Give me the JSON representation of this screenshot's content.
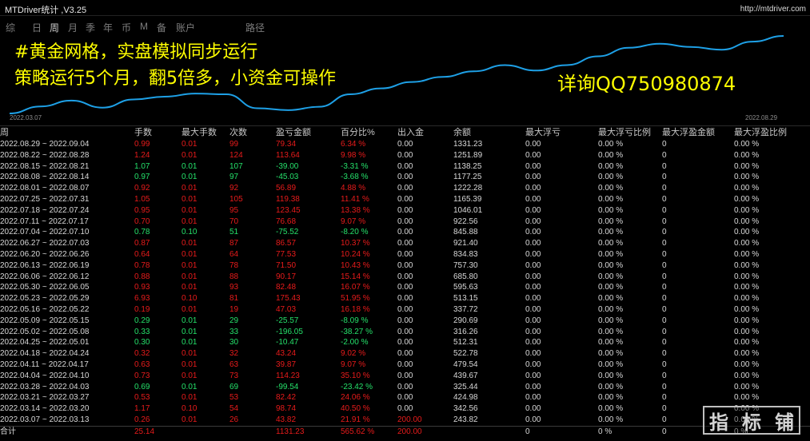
{
  "window": {
    "title": "MTDriver统计 ,V3.25",
    "link": "http://mtdriver.com"
  },
  "tabs": [
    "综",
    "日",
    "周",
    "月",
    "季",
    "年",
    "币",
    "M",
    "备",
    "账户",
    "路径"
  ],
  "active_tab": "周",
  "promo": {
    "line1": "#黄金网格，实盘模拟同步运行",
    "line2": "策略运行5个月，翻5倍多，小资金可操作",
    "contact": "详询QQ750980874"
  },
  "colors": {
    "curve": "#1ea0e6",
    "promo": "#ffff00",
    "positive": "#e81b1b",
    "negative": "#25e06a"
  },
  "chart_data": {
    "type": "line",
    "x_start": "2022.03.07",
    "x_end": "2022.08.29",
    "series": [
      {
        "values": [
          243.82,
          342.56,
          424.98,
          325.44,
          439.67,
          479.54,
          522.78,
          512.31,
          316.26,
          290.69,
          337.72,
          513.15,
          595.63,
          685.8,
          757.3,
          834.83,
          921.4,
          845.88,
          922.56,
          1046.01,
          1165.39,
          1222.28,
          1177.25,
          1138.25,
          1251.89,
          1331.23
        ]
      }
    ]
  },
  "table": {
    "headers": [
      "周",
      "手数",
      "最大手数",
      "次数",
      "盈亏金额",
      "百分比%",
      "出入金",
      "余额",
      "最大浮亏",
      "最大浮亏比例",
      "最大浮盈金额",
      "最大浮盈比例"
    ],
    "rows": [
      [
        "2022.08.29 ~ 2022.09.04",
        "0.99",
        "0.01",
        "99",
        "79.34",
        "6.34 %",
        "0.00",
        "1331.23",
        "0.00",
        "0.00 %",
        "0",
        "0.00 %"
      ],
      [
        "2022.08.22 ~ 2022.08.28",
        "1.24",
        "0.01",
        "124",
        "113.64",
        "9.98 %",
        "0.00",
        "1251.89",
        "0.00",
        "0.00 %",
        "0",
        "0.00 %"
      ],
      [
        "2022.08.15 ~ 2022.08.21",
        "1.07",
        "0.01",
        "107",
        "-39.00",
        "-3.31 %",
        "0.00",
        "1138.25",
        "0.00",
        "0.00 %",
        "0",
        "0.00 %"
      ],
      [
        "2022.08.08 ~ 2022.08.14",
        "0.97",
        "0.01",
        "97",
        "-45.03",
        "-3.68 %",
        "0.00",
        "1177.25",
        "0.00",
        "0.00 %",
        "0",
        "0.00 %"
      ],
      [
        "2022.08.01 ~ 2022.08.07",
        "0.92",
        "0.01",
        "92",
        "56.89",
        "4.88 %",
        "0.00",
        "1222.28",
        "0.00",
        "0.00 %",
        "0",
        "0.00 %"
      ],
      [
        "2022.07.25 ~ 2022.07.31",
        "1.05",
        "0.01",
        "105",
        "119.38",
        "11.41 %",
        "0.00",
        "1165.39",
        "0.00",
        "0.00 %",
        "0",
        "0.00 %"
      ],
      [
        "2022.07.18 ~ 2022.07.24",
        "0.95",
        "0.01",
        "95",
        "123.45",
        "13.38 %",
        "0.00",
        "1046.01",
        "0.00",
        "0.00 %",
        "0",
        "0.00 %"
      ],
      [
        "2022.07.11 ~ 2022.07.17",
        "0.70",
        "0.01",
        "70",
        "76.68",
        "9.07 %",
        "0.00",
        "922.56",
        "0.00",
        "0.00 %",
        "0",
        "0.00 %"
      ],
      [
        "2022.07.04 ~ 2022.07.10",
        "0.78",
        "0.10",
        "51",
        "-75.52",
        "-8.20 %",
        "0.00",
        "845.88",
        "0.00",
        "0.00 %",
        "0",
        "0.00 %"
      ],
      [
        "2022.06.27 ~ 2022.07.03",
        "0.87",
        "0.01",
        "87",
        "86.57",
        "10.37 %",
        "0.00",
        "921.40",
        "0.00",
        "0.00 %",
        "0",
        "0.00 %"
      ],
      [
        "2022.06.20 ~ 2022.06.26",
        "0.64",
        "0.01",
        "64",
        "77.53",
        "10.24 %",
        "0.00",
        "834.83",
        "0.00",
        "0.00 %",
        "0",
        "0.00 %"
      ],
      [
        "2022.06.13 ~ 2022.06.19",
        "0.78",
        "0.01",
        "78",
        "71.50",
        "10.43 %",
        "0.00",
        "757.30",
        "0.00",
        "0.00 %",
        "0",
        "0.00 %"
      ],
      [
        "2022.06.06 ~ 2022.06.12",
        "0.88",
        "0.01",
        "88",
        "90.17",
        "15.14 %",
        "0.00",
        "685.80",
        "0.00",
        "0.00 %",
        "0",
        "0.00 %"
      ],
      [
        "2022.05.30 ~ 2022.06.05",
        "0.93",
        "0.01",
        "93",
        "82.48",
        "16.07 %",
        "0.00",
        "595.63",
        "0.00",
        "0.00 %",
        "0",
        "0.00 %"
      ],
      [
        "2022.05.23 ~ 2022.05.29",
        "6.93",
        "0.10",
        "81",
        "175.43",
        "51.95 %",
        "0.00",
        "513.15",
        "0.00",
        "0.00 %",
        "0",
        "0.00 %"
      ],
      [
        "2022.05.16 ~ 2022.05.22",
        "0.19",
        "0.01",
        "19",
        "47.03",
        "16.18 %",
        "0.00",
        "337.72",
        "0.00",
        "0.00 %",
        "0",
        "0.00 %"
      ],
      [
        "2022.05.09 ~ 2022.05.15",
        "0.29",
        "0.01",
        "29",
        "-25.57",
        "-8.09 %",
        "0.00",
        "290.69",
        "0.00",
        "0.00 %",
        "0",
        "0.00 %"
      ],
      [
        "2022.05.02 ~ 2022.05.08",
        "0.33",
        "0.01",
        "33",
        "-196.05",
        "-38.27 %",
        "0.00",
        "316.26",
        "0.00",
        "0.00 %",
        "0",
        "0.00 %"
      ],
      [
        "2022.04.25 ~ 2022.05.01",
        "0.30",
        "0.01",
        "30",
        "-10.47",
        "-2.00 %",
        "0.00",
        "512.31",
        "0.00",
        "0.00 %",
        "0",
        "0.00 %"
      ],
      [
        "2022.04.18 ~ 2022.04.24",
        "0.32",
        "0.01",
        "32",
        "43.24",
        "9.02 %",
        "0.00",
        "522.78",
        "0.00",
        "0.00 %",
        "0",
        "0.00 %"
      ],
      [
        "2022.04.11 ~ 2022.04.17",
        "0.63",
        "0.01",
        "63",
        "39.87",
        "9.07 %",
        "0.00",
        "479.54",
        "0.00",
        "0.00 %",
        "0",
        "0.00 %"
      ],
      [
        "2022.04.04 ~ 2022.04.10",
        "0.73",
        "0.01",
        "73",
        "114.23",
        "35.10 %",
        "0.00",
        "439.67",
        "0.00",
        "0.00 %",
        "0",
        "0.00 %"
      ],
      [
        "2022.03.28 ~ 2022.04.03",
        "0.69",
        "0.01",
        "69",
        "-99.54",
        "-23.42 %",
        "0.00",
        "325.44",
        "0.00",
        "0.00 %",
        "0",
        "0.00 %"
      ],
      [
        "2022.03.21 ~ 2022.03.27",
        "0.53",
        "0.01",
        "53",
        "82.42",
        "24.06 %",
        "0.00",
        "424.98",
        "0.00",
        "0.00 %",
        "0",
        "0.00 %"
      ],
      [
        "2022.03.14 ~ 2022.03.20",
        "1.17",
        "0.10",
        "54",
        "98.74",
        "40.50 %",
        "0.00",
        "342.56",
        "0.00",
        "0.00 %",
        "0",
        "0.00 %"
      ],
      [
        "2022.03.07 ~ 2022.03.13",
        "0.26",
        "0.01",
        "26",
        "43.82",
        "21.91 %",
        "200.00",
        "243.82",
        "0.00",
        "0.00 %",
        "0",
        "0.00 %"
      ]
    ],
    "total": [
      "合计",
      "25.14",
      "",
      "",
      "1131.23",
      "565.62 %",
      "200.00",
      "",
      "0",
      "0 %",
      "0",
      "0 %"
    ]
  },
  "watermark": "指标铺"
}
